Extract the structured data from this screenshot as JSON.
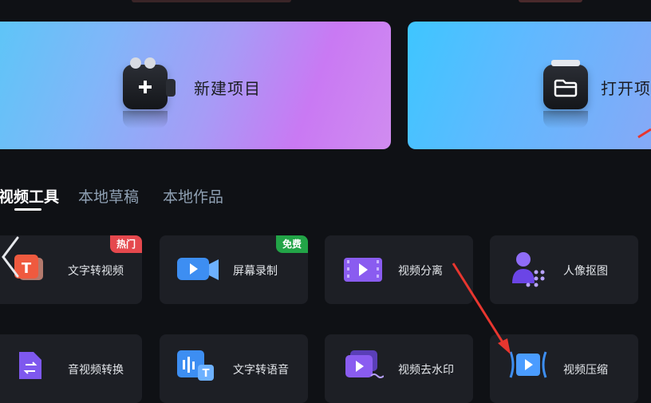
{
  "hero": {
    "new_project_label": "新建项目",
    "open_project_label": "打开项"
  },
  "tabs": [
    {
      "label": "视频工具",
      "active": true
    },
    {
      "label": "本地草稿",
      "active": false
    },
    {
      "label": "本地作品",
      "active": false
    }
  ],
  "tools": [
    {
      "label": "文字转视频",
      "badge": "热门",
      "badge_color": "#e5484d",
      "icon": "text-to-video-icon"
    },
    {
      "label": "屏幕录制",
      "badge": "免费",
      "badge_color": "#22a447",
      "icon": "screen-record-icon"
    },
    {
      "label": "视频分离",
      "icon": "video-split-icon"
    },
    {
      "label": "人像抠图",
      "icon": "portrait-cutout-icon"
    },
    {
      "label": "音视频转换",
      "icon": "av-convert-icon"
    },
    {
      "label": "文字转语音",
      "icon": "text-to-speech-icon"
    },
    {
      "label": "视频去水印",
      "icon": "remove-watermark-icon"
    },
    {
      "label": "视频压缩",
      "icon": "video-compress-icon"
    }
  ],
  "colors": {
    "background": "#0f1115",
    "card": "#1d1f25",
    "annotation_arrow": "#e8362f"
  }
}
